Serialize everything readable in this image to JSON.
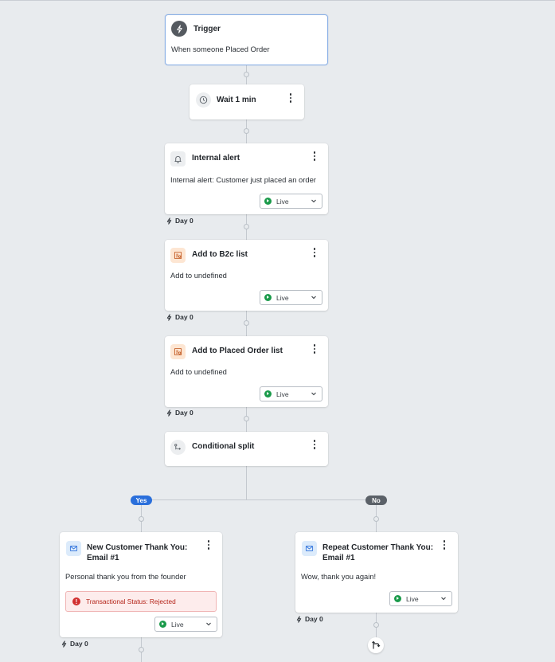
{
  "flow": {
    "trigger": {
      "title": "Trigger",
      "description": "When someone Placed Order",
      "icon": "lightning-bolt-icon"
    },
    "wait": {
      "title": "Wait 1 min",
      "icon": "clock-icon"
    },
    "internal_alert": {
      "title": "Internal alert",
      "description": "Internal alert: Customer just placed an order",
      "status": "Live",
      "day": "Day 0",
      "icon": "bell-icon"
    },
    "add_b2c": {
      "title": "Add to B2c list",
      "description": "Add to undefined",
      "status": "Live",
      "day": "Day 0",
      "icon": "list-add-icon"
    },
    "add_placed_order": {
      "title": "Add to Placed Order list",
      "description": "Add to undefined",
      "status": "Live",
      "day": "Day 0",
      "icon": "list-add-icon"
    },
    "conditional_split": {
      "title": "Conditional split",
      "icon": "split-icon"
    },
    "branches": {
      "yes_label": "Yes",
      "no_label": "No"
    },
    "new_customer_email": {
      "title_line1": "New Customer Thank You:",
      "title_line2": "Email #1",
      "description": "Personal thank you from the founder",
      "alert": "Transactional Status: Rejected",
      "status": "Live",
      "day": "Day 0",
      "icon": "envelope-icon"
    },
    "repeat_customer_email": {
      "title_line1": "Repeat Customer Thank You:",
      "title_line2": "Email #1",
      "description": "Wow, thank you again!",
      "status": "Live",
      "day": "Day 0",
      "icon": "envelope-icon"
    }
  },
  "colors": {
    "canvas": "#e8ebee",
    "live_green": "#1a9a4a",
    "yes_blue": "#2a6fdb",
    "no_grey": "#5b6168",
    "error_red": "#d12f2f",
    "selected_border": "#8ab0e6"
  }
}
